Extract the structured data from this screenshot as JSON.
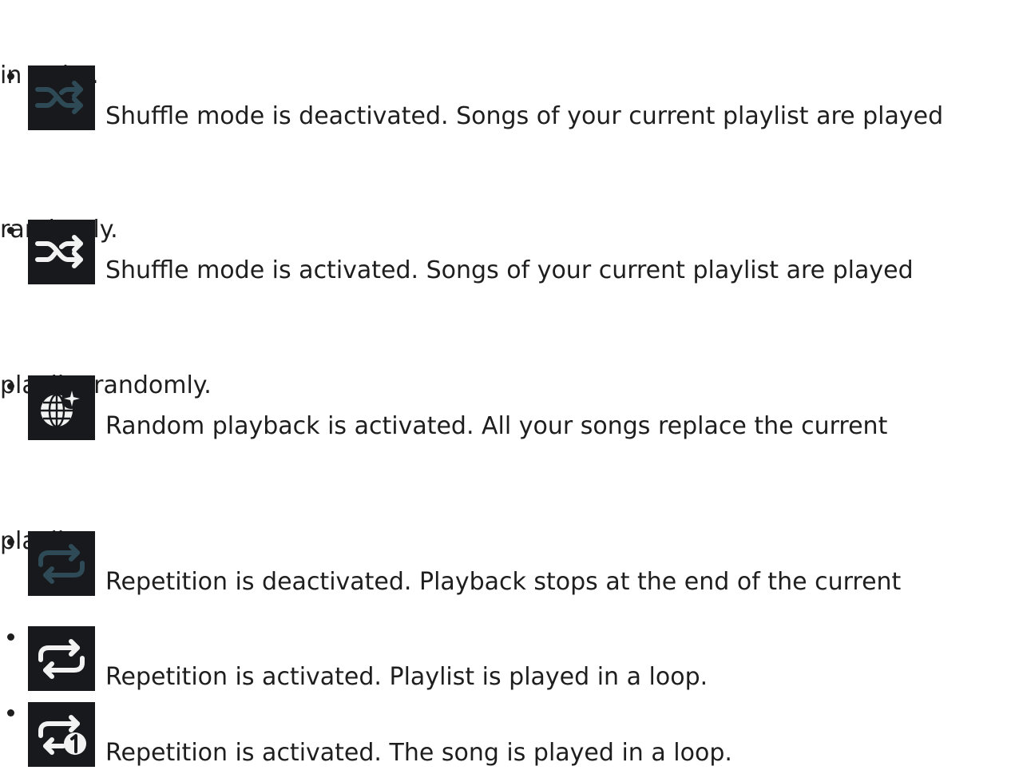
{
  "items": [
    {
      "icon": "shuffle-off-icon",
      "icon_color": "#2e4a56",
      "first_line": "Shuffle mode is deactivated. Songs of your current playlist are played",
      "second_line": "in order."
    },
    {
      "icon": "shuffle-on-icon",
      "icon_color": "#f2f2f2",
      "first_line": "Shuffle mode is activated. Songs of your current playlist are played",
      "second_line": "randomly."
    },
    {
      "icon": "random-playback-icon",
      "icon_color": "#f2f2f2",
      "first_line": "Random playback is activated. All your songs replace the current",
      "second_line": "playlist randomly."
    },
    {
      "icon": "repeat-off-icon",
      "icon_color": "#2e4a56",
      "first_line": "Repetition is deactivated. Playback stops at the end of the current",
      "second_line": "playlist."
    },
    {
      "icon": "repeat-on-icon",
      "icon_color": "#f2f2f2",
      "first_line": "Repetition is activated. Playlist is played in a loop.",
      "second_line": ""
    },
    {
      "icon": "repeat-one-icon",
      "icon_color": "#f2f2f2",
      "first_line": "Repetition is activated. The song is played in a loop.",
      "second_line": ""
    }
  ]
}
